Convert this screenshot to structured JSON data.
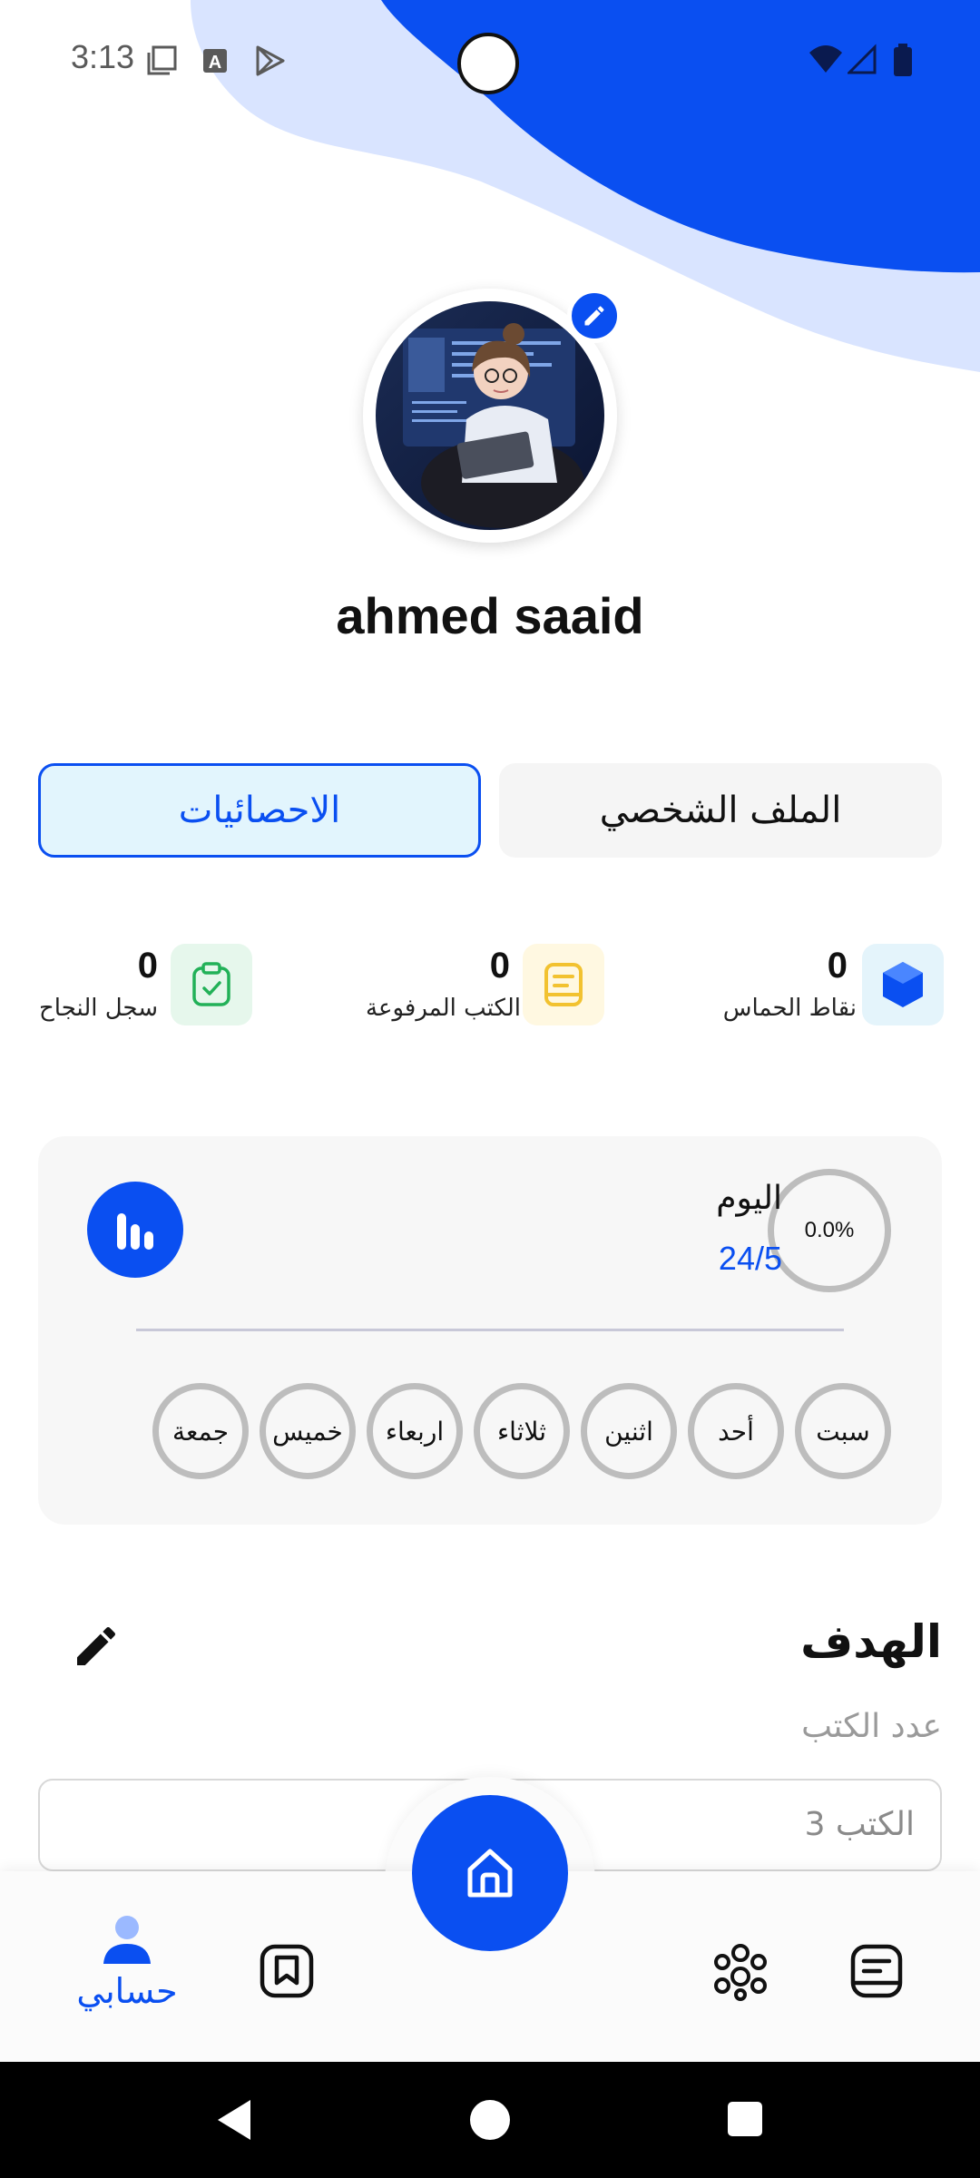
{
  "status_bar": {
    "time": "3:13",
    "icons": [
      "screen-icon",
      "a-badge-icon",
      "play-store-icon",
      "wifi-icon",
      "signal-icon",
      "battery-icon"
    ]
  },
  "profile": {
    "name": "ahmed saaid",
    "avatar": "avatar-illustration",
    "edit_icon": "pencil-icon"
  },
  "tabs": [
    {
      "label": "الاحصائيات",
      "active": true
    },
    {
      "label": "الملف الشخصي",
      "active": false
    }
  ],
  "stats": [
    {
      "value": "0",
      "label": "نقاط الحماس",
      "icon": "hexagon-icon",
      "color": "#0a4ff1",
      "bg": "#e4f4fb"
    },
    {
      "value": "0",
      "label": "الكتب المرفوعة",
      "icon": "book-icon",
      "color": "#f2c230",
      "bg": "#fff8e1"
    },
    {
      "value": "0",
      "label": "سجل النجاح",
      "icon": "clipboard-check-icon",
      "color": "#22b158",
      "bg": "#e6f7ec"
    }
  ],
  "weekly": {
    "today_label": "اليوم",
    "today_count": "24/5",
    "progress": "0.0%",
    "days": [
      "سبت",
      "أحد",
      "اثنين",
      "ثلاثاء",
      "اربعاء",
      "خميس",
      "جمعة"
    ]
  },
  "goal": {
    "title": "الهدف",
    "subtitle": "عدد الكتب",
    "input_value": "3 الكتب"
  },
  "bottom_nav": {
    "active_label": "حسابي",
    "items": [
      "account-icon",
      "bookmark-icon",
      "home-icon",
      "community-icon",
      "notes-icon"
    ]
  },
  "colors": {
    "accent": "#0a4ff1",
    "light_blob": "#d9e4ff",
    "tab_active_bg": "#e2f5fd"
  }
}
